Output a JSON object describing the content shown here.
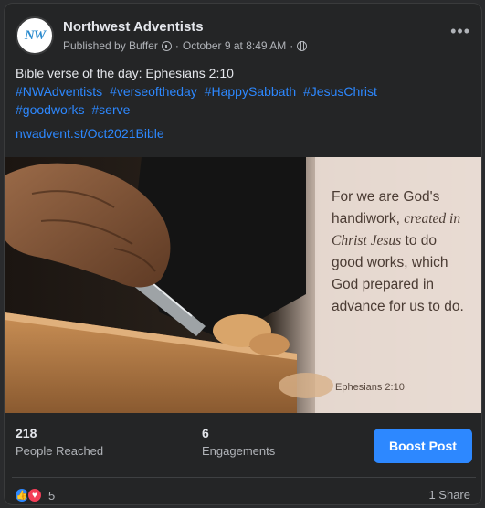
{
  "post": {
    "page_name": "Northwest Adventists",
    "avatar_text": "NW",
    "published_by": "Published by Buffer",
    "date": "October 9 at 8:49 AM",
    "text_line": "Bible verse of the day: Ephesians 2:10",
    "hashtags": [
      "#NWAdventists",
      "#verseoftheday",
      "#HappySabbath",
      "#JesusChrist",
      "#goodworks",
      "#serve"
    ],
    "link": "nwadvent.st/Oct2021Bible"
  },
  "image": {
    "verse_lines": [
      "For we are God's",
      "handiwork,",
      "created in",
      "Christ Jesus",
      "to do",
      "good works, which",
      "God prepared in",
      "advance for us to do."
    ],
    "reference": "Ephesians 2:10"
  },
  "stats": {
    "reached_value": "218",
    "reached_label": "People Reached",
    "engagements_value": "6",
    "engagements_label": "Engagements",
    "boost_label": "Boost Post"
  },
  "footer": {
    "reaction_count": "5",
    "share_text": "1 Share"
  },
  "colors": {
    "accent": "#2d88ff",
    "background": "#242526",
    "love": "#f33e58"
  },
  "icons": [
    "more-options-icon",
    "info-icon",
    "globe-icon",
    "like-reaction-icon",
    "love-reaction-icon"
  ]
}
